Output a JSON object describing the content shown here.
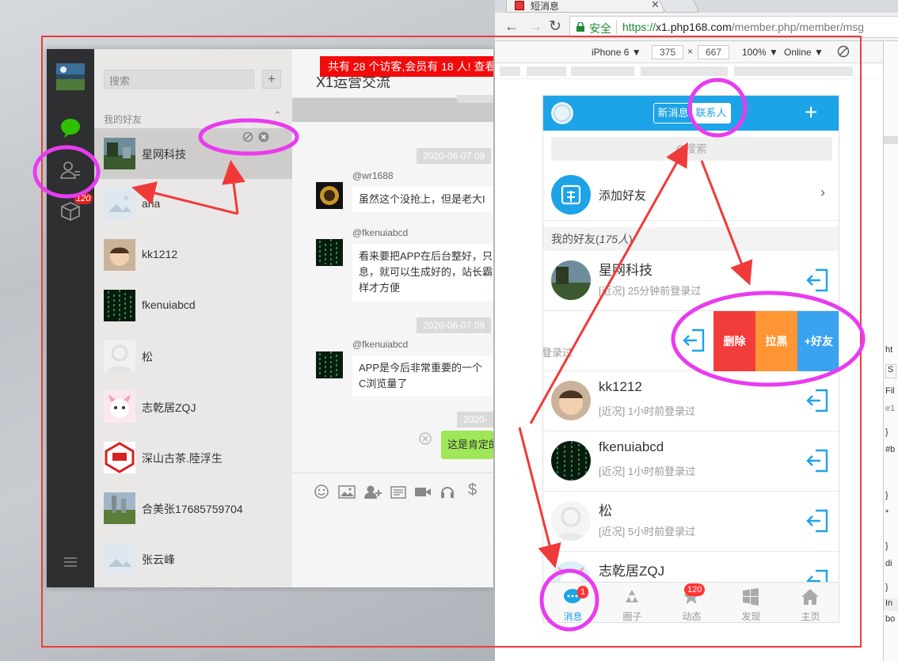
{
  "desktop_app": {
    "search_placeholder": "搜索",
    "add_label": "+",
    "group_label": "我的好友",
    "chat_title": "X1运营交流",
    "banner_text": "共有 28 个访客,会员有 18 人! 查看",
    "rail_badge": "120",
    "contacts": [
      {
        "name": "星网科技"
      },
      {
        "name": "aria"
      },
      {
        "name": "kk1212"
      },
      {
        "name": "fkenuiabcd"
      },
      {
        "name": "松"
      },
      {
        "name": "志乾居ZQJ"
      },
      {
        "name": "深山古茶.陸浮生"
      },
      {
        "name": "合美张17685759704"
      },
      {
        "name": "张云峰"
      }
    ],
    "messages": [
      {
        "time": "2020-06-07 09",
        "nick": "@wr1688",
        "lines": [
          "虽然这个没抢上，但是老大I"
        ]
      },
      {
        "nick": "@fkenuiabcd",
        "lines": [
          "看来要把APP在后台整好，只",
          "息，就可以生成好的，站长霸",
          "样才方便"
        ]
      },
      {
        "time": "2020-06-07 09",
        "nick": "@fkenuiabcd",
        "lines": [
          "APP是今后非常重要的一个",
          "C浏览量了"
        ]
      },
      {
        "time": "2020-",
        "self_text": "这是肯定的"
      }
    ]
  },
  "browser": {
    "tab_title": "短消息",
    "secure_label": "安全",
    "url_scheme": "https://",
    "url_host": "x1.php168.com",
    "url_path": "/member.php/member/msg",
    "device": "iPhone 6 ▼",
    "width": "375",
    "height": "667",
    "zoom": "100% ▼",
    "network": "Online ▼",
    "devtools_fragments": [
      "ht",
      "S",
      "Fil",
      "e1",
      "}",
      "#b",
      "}",
      "*",
      "}",
      "di",
      "}",
      "In",
      "bo"
    ]
  },
  "phone": {
    "tab_new_msg": "新消息",
    "tab_contacts": "联系人",
    "plus": "+",
    "search_placeholder": "Q搜索",
    "add_friend": "添加好友",
    "group_label": "我的好友(",
    "group_count": "175人",
    "group_close": ")",
    "friends": [
      {
        "name": "星网科技",
        "status": "[近况] 25分钟前登录过"
      },
      {
        "name": "kk1212",
        "status": "[近况] 1小时前登录过"
      },
      {
        "name": "fkenuiabcd",
        "status": "[近况] 1小时前登录过"
      },
      {
        "name": "松",
        "status": "[近况] 5小时前登录过"
      },
      {
        "name": "志乾居ZQJ",
        "status": ""
      }
    ],
    "swipe_row": {
      "partial_status": "登录过",
      "delete": "删除",
      "block": "拉黑",
      "add_friend": "+好友"
    },
    "bottom_tabs": [
      {
        "label": "消息",
        "badge": "1"
      },
      {
        "label": "圈子",
        "badge": ""
      },
      {
        "label": "动态",
        "badge": "120"
      },
      {
        "label": "发现",
        "badge": ""
      },
      {
        "label": "主页",
        "badge": ""
      }
    ]
  },
  "colors": {
    "accent": "#1da3e7",
    "delete": "#f23b3b",
    "block": "#ff9633",
    "add_friend": "#39a3f0",
    "annotation": "#e83cf0",
    "arrow": "#f03a3a"
  }
}
